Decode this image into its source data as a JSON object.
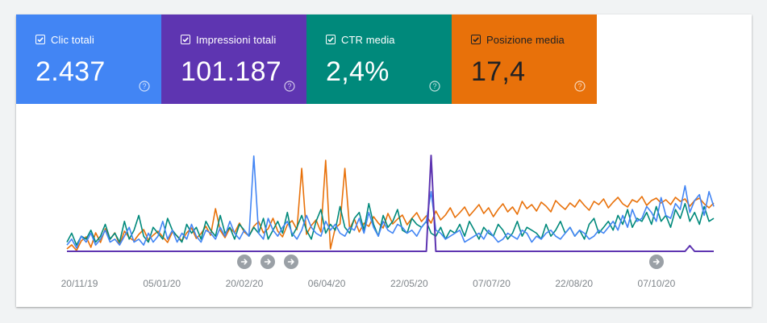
{
  "metrics": {
    "clicks": {
      "label": "Clic totali",
      "value": "2.437",
      "color": "#4285f4",
      "checked": true
    },
    "impressions": {
      "label": "Impressioni totali",
      "value": "101.187",
      "color": "#5e35b1",
      "checked": true
    },
    "ctr": {
      "label": "CTR media",
      "value": "2,4%",
      "color": "#00897b",
      "checked": true
    },
    "position": {
      "label": "Posizione media",
      "value": "17,4",
      "color": "#e8710a",
      "checked": true
    }
  },
  "icons": {
    "checkbox": "check-icon",
    "help": "help-circle-icon",
    "annotation": "arrow-right-icon"
  },
  "chart_data": {
    "type": "line",
    "x_labels": [
      "20/11/19",
      "05/01/20",
      "20/02/20",
      "06/04/20",
      "22/05/20",
      "07/07/20",
      "22/08/20",
      "07/10/20"
    ],
    "x_range": [
      "2019-11-13",
      "2020-11-08"
    ],
    "annotations": [
      "2020-02-20",
      "2020-03-04",
      "2020-03-17",
      "2020-10-07"
    ],
    "grid": false,
    "series": [
      {
        "name": "Clic totali",
        "color": "#4285f4",
        "values": [
          4,
          6,
          3,
          7,
          5,
          8,
          4,
          6,
          9,
          5,
          6,
          4,
          7,
          10,
          5,
          6,
          4,
          8,
          5,
          7,
          12,
          6,
          9,
          5,
          8,
          6,
          11,
          7,
          5,
          9,
          8,
          6,
          10,
          7,
          12,
          8,
          6,
          9,
          7,
          34,
          8,
          6,
          13,
          9,
          7,
          10,
          12,
          8,
          6,
          9,
          14,
          10,
          8,
          7,
          12,
          9,
          11,
          8,
          7,
          10,
          9,
          13,
          8,
          15,
          10,
          7,
          12,
          9,
          8,
          11,
          10,
          8,
          9,
          7,
          10,
          12,
          22,
          9,
          8,
          6,
          7,
          8,
          9,
          5,
          6,
          7,
          8,
          6,
          9,
          7,
          5,
          6,
          8,
          7,
          6,
          9,
          8,
          5,
          7,
          6,
          8,
          9,
          7,
          6,
          8,
          10,
          7,
          9,
          8,
          6,
          7,
          9,
          8,
          10,
          12,
          9,
          14,
          10,
          16,
          12,
          13,
          17,
          15,
          12,
          20,
          14,
          13,
          18,
          16,
          24,
          15,
          19,
          21,
          14,
          22,
          17
        ]
      },
      {
        "name": "Impressioni totali",
        "color": "#5e35b1",
        "values": [
          1,
          1,
          1,
          1,
          1,
          1,
          1,
          1,
          1,
          1,
          1,
          1,
          1,
          1,
          1,
          1,
          1,
          1,
          1,
          1,
          1,
          1,
          1,
          1,
          1,
          1,
          1,
          1,
          1,
          1,
          1,
          1,
          1,
          1,
          1,
          1,
          1,
          1,
          1,
          1,
          1,
          1,
          1,
          1,
          1,
          1,
          1,
          1,
          1,
          1,
          1,
          1,
          1,
          1,
          1,
          1,
          1,
          1,
          1,
          1,
          1,
          1,
          1,
          1,
          1,
          1,
          1,
          1,
          1,
          1,
          1,
          1,
          1,
          1,
          1,
          1,
          18,
          1,
          1,
          1,
          1,
          1,
          1,
          1,
          1,
          1,
          1,
          1,
          1,
          1,
          1,
          1,
          1,
          1,
          1,
          1,
          1,
          1,
          1,
          1,
          1,
          1,
          1,
          1,
          1,
          1,
          1,
          1,
          1,
          1,
          1,
          1,
          1,
          1,
          1,
          1,
          1,
          1,
          1,
          1,
          1,
          1,
          1,
          1,
          1,
          1,
          1,
          1,
          1,
          1,
          2,
          1,
          1,
          1,
          1,
          1
        ]
      },
      {
        "name": "CTR media",
        "color": "#00897b",
        "values": [
          5,
          8,
          4,
          7,
          6,
          9,
          5,
          7,
          11,
          6,
          8,
          5,
          12,
          6,
          9,
          14,
          7,
          5,
          10,
          8,
          6,
          13,
          9,
          7,
          5,
          11,
          8,
          10,
          6,
          12,
          9,
          7,
          14,
          8,
          10,
          6,
          11,
          9,
          7,
          10,
          8,
          13,
          6,
          9,
          12,
          8,
          15,
          7,
          10,
          14,
          9,
          6,
          12,
          16,
          8,
          11,
          9,
          17,
          10,
          8,
          13,
          15,
          9,
          18,
          11,
          7,
          14,
          10,
          12,
          16,
          9,
          8,
          13,
          11,
          10,
          12,
          8,
          7,
          10,
          6,
          9,
          8,
          11,
          7,
          12,
          9,
          6,
          10,
          8,
          7,
          11,
          9,
          6,
          8,
          12,
          7,
          10,
          9,
          8,
          6,
          11,
          7,
          9,
          12,
          8,
          10,
          7,
          9,
          6,
          11,
          13,
          8,
          10,
          12,
          9,
          14,
          11,
          16,
          10,
          13,
          12,
          15,
          11,
          17,
          12,
          14,
          10,
          16,
          13,
          18,
          12,
          15,
          11,
          17,
          12,
          13
        ]
      },
      {
        "name": "Posizione media",
        "color": "#e8710a",
        "values": [
          21,
          20.5,
          21.2,
          20,
          19.5,
          20.8,
          19,
          20.2,
          18.5,
          19.8,
          19,
          20.5,
          18.8,
          19.6,
          20,
          19.2,
          18.6,
          19.9,
          19.3,
          18.8,
          19.5,
          20.2,
          18.9,
          19.4,
          20,
          19,
          18.4,
          19.7,
          19.1,
          18.2,
          19.3,
          16,
          18.7,
          19.6,
          18.4,
          19,
          17.8,
          18.9,
          19.4,
          18.2,
          17.6,
          19,
          18.5,
          17.2,
          18.8,
          19.5,
          18,
          17.5,
          18.6,
          11,
          19.2,
          18.1,
          17.4,
          18.9,
          10,
          21,
          18.4,
          17.9,
          11,
          18.5,
          17.3,
          18.9,
          17.8,
          18.2,
          17,
          17.8,
          18.4,
          16.6,
          17.9,
          17.3,
          16.8,
          18,
          17.2,
          16.5,
          17.6,
          16.9,
          17.8,
          16.3,
          17.4,
          16.8,
          15.9,
          17.1,
          16.5,
          15.8,
          16.9,
          16.2,
          15.5,
          16.6,
          15.9,
          17,
          16.1,
          15.4,
          16.4,
          15.8,
          16.7,
          15.1,
          16,
          15.5,
          16.3,
          15.2,
          15.7,
          16.4,
          15,
          15.6,
          16.1,
          15.3,
          15.8,
          14.9,
          15.6,
          16.2,
          15.1,
          15.5,
          14.8,
          15.9,
          15.2,
          14.6,
          15.4,
          15.8,
          14.9,
          15.2,
          14.5,
          15.6,
          15,
          14.7,
          15.3,
          14.9,
          15.5,
          14.6,
          15.1,
          14.8,
          15.7,
          15,
          14.7,
          15.4,
          15.9,
          15.3
        ]
      }
    ]
  }
}
